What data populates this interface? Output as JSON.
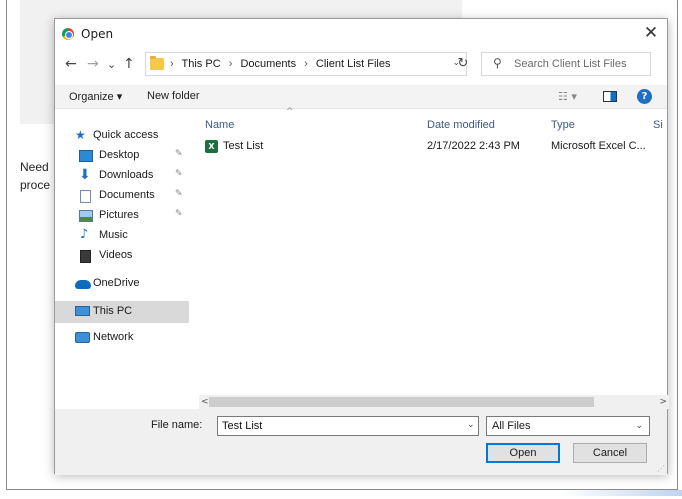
{
  "background": {
    "text_line1": "Need",
    "text_line2": "proce"
  },
  "dialog": {
    "title": "Open",
    "close_glyph": "✕"
  },
  "nav": {
    "back": "←",
    "forward": "→",
    "history": "⌄",
    "up": "↑",
    "breadcrumb": [
      "This PC",
      "Documents",
      "Client List Files"
    ],
    "breadcrumb_sep": "›",
    "addr_dropdown": "⌄",
    "refresh": "↻",
    "search_placeholder": "Search Client List Files"
  },
  "toolbar": {
    "organize": "Organize ▾",
    "new_folder": "New folder",
    "view_glyph": "☷ ▾",
    "help": "?"
  },
  "sidebar": {
    "items": [
      {
        "label": "Quick access",
        "icon": "star-icon",
        "pinned": false
      },
      {
        "label": "Desktop",
        "icon": "desktop-icon",
        "pinned": true
      },
      {
        "label": "Downloads",
        "icon": "download-icon",
        "pinned": true
      },
      {
        "label": "Documents",
        "icon": "documents-icon",
        "pinned": true
      },
      {
        "label": "Pictures",
        "icon": "pictures-icon",
        "pinned": true
      },
      {
        "label": "Music",
        "icon": "music-icon",
        "pinned": false
      },
      {
        "label": "Videos",
        "icon": "videos-icon",
        "pinned": false
      },
      {
        "label": "OneDrive",
        "icon": "cloud-icon",
        "pinned": false
      },
      {
        "label": "This PC",
        "icon": "computer-icon",
        "pinned": false,
        "selected": true
      },
      {
        "label": "Network",
        "icon": "network-icon",
        "pinned": false
      }
    ],
    "pin_glyph": "📌"
  },
  "list": {
    "columns": [
      "Name",
      "Date modified",
      "Type",
      "Si"
    ],
    "sort_caret": "^",
    "rows": [
      {
        "name": "Test List",
        "date": "2/17/2022 2:43 PM",
        "type": "Microsoft Excel C...",
        "icon": "excel-file-icon"
      }
    ]
  },
  "scrollbar": {
    "left": "<",
    "right": ">"
  },
  "footer": {
    "file_name_label": "File name:",
    "file_name_value": "Test List",
    "file_name_drop": "⌄",
    "file_type": "All Files",
    "file_type_drop": "⌄",
    "open_label": "Open",
    "cancel_label": "Cancel",
    "grip": "⋰"
  },
  "colors": {
    "accent": "#0078d7",
    "excel": "#1d6f42",
    "folder": "#f6c94b",
    "selected": "#d9d9d9",
    "header_text": "#3d5a80"
  }
}
